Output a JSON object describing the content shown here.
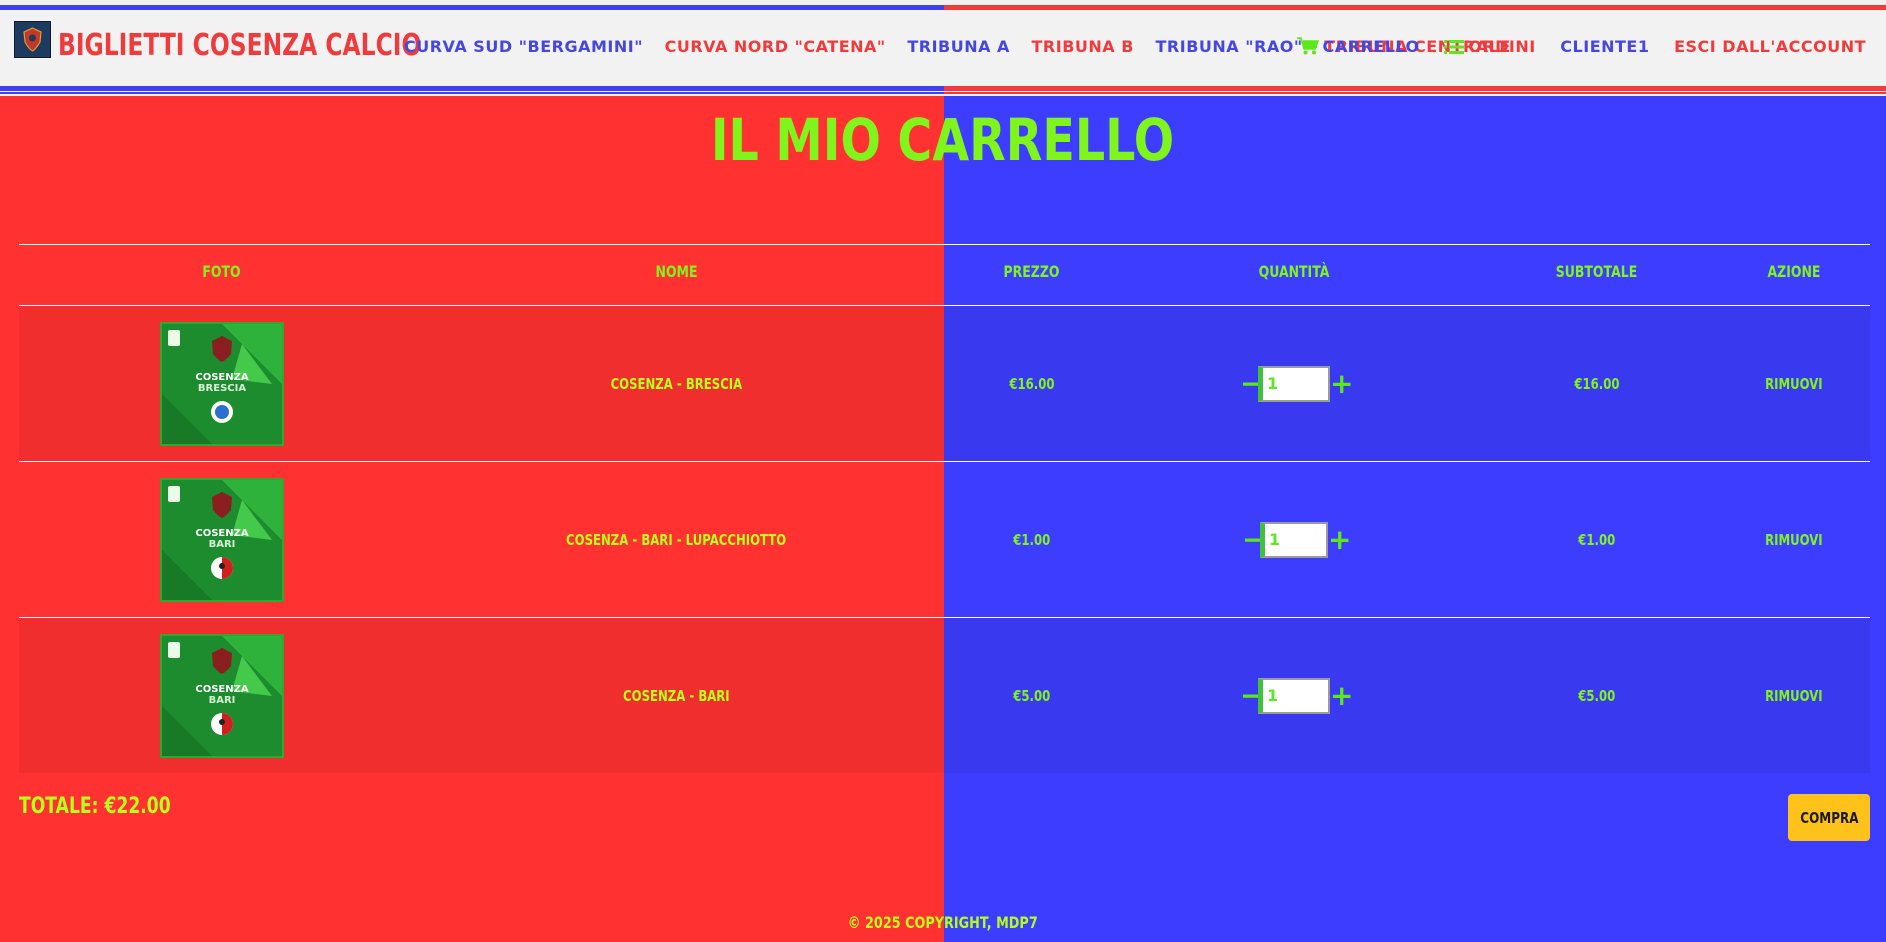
{
  "header": {
    "brand": "BIGLIETTI COSENZA CALCIO",
    "nav_left": [
      {
        "label": "CURVA SUD \"BERGAMINI\"",
        "color": "blue"
      },
      {
        "label": "CURVA NORD \"CATENA\"",
        "color": "red"
      },
      {
        "label": "TRIBUNA A",
        "color": "blue"
      },
      {
        "label": "TRIBUNA B",
        "color": "red"
      },
      {
        "label": "TRIBUNA \"RAO\"",
        "color": "blue"
      },
      {
        "label": "TRIBUNA CENTRALE",
        "color": "red"
      }
    ],
    "nav_right": [
      {
        "label": "CARRELLO",
        "icon": "cart-icon"
      },
      {
        "label": "ORDINI",
        "icon": "list-icon"
      },
      {
        "label": "CLIENTE1"
      },
      {
        "label": "ESCI DALL'ACCOUNT"
      }
    ]
  },
  "page": {
    "title": "IL MIO CARRELLO"
  },
  "table": {
    "headers": [
      "FOTO",
      "NOME",
      "PREZZO",
      "QUANTITÀ",
      "SUBTOTALE",
      "AZIONE"
    ],
    "rows": [
      {
        "name": "COSENZA - BRESCIA",
        "price": "€16.00",
        "quantity": "1",
        "subtotal": "€16.00",
        "action": "RIMUOVI",
        "thumb_text": [
          "COSENZA",
          "BRESCIA"
        ]
      },
      {
        "name": "COSENZA - BARI - LUPACCHIOTTO",
        "price": "€1.00",
        "quantity": "1",
        "subtotal": "€1.00",
        "action": "RIMUOVI",
        "thumb_text": [
          "COSENZA",
          "BARI"
        ]
      },
      {
        "name": "COSENZA - BARI",
        "price": "€5.00",
        "quantity": "1",
        "subtotal": "€5.00",
        "action": "RIMUOVI",
        "thumb_text": [
          "COSENZA",
          "BARI"
        ]
      }
    ]
  },
  "summary": {
    "total": "TOTALE: €22.00",
    "buy_label": "COMPRA"
  },
  "footer": {
    "copyright": "© 2025 COPYRIGHT, MDP7"
  },
  "colors": {
    "red": "#ff3131",
    "blue": "#3d3dff",
    "accent": "#80f51b",
    "header_bg": "#f2f2f2",
    "buy": "#ffc21a"
  }
}
